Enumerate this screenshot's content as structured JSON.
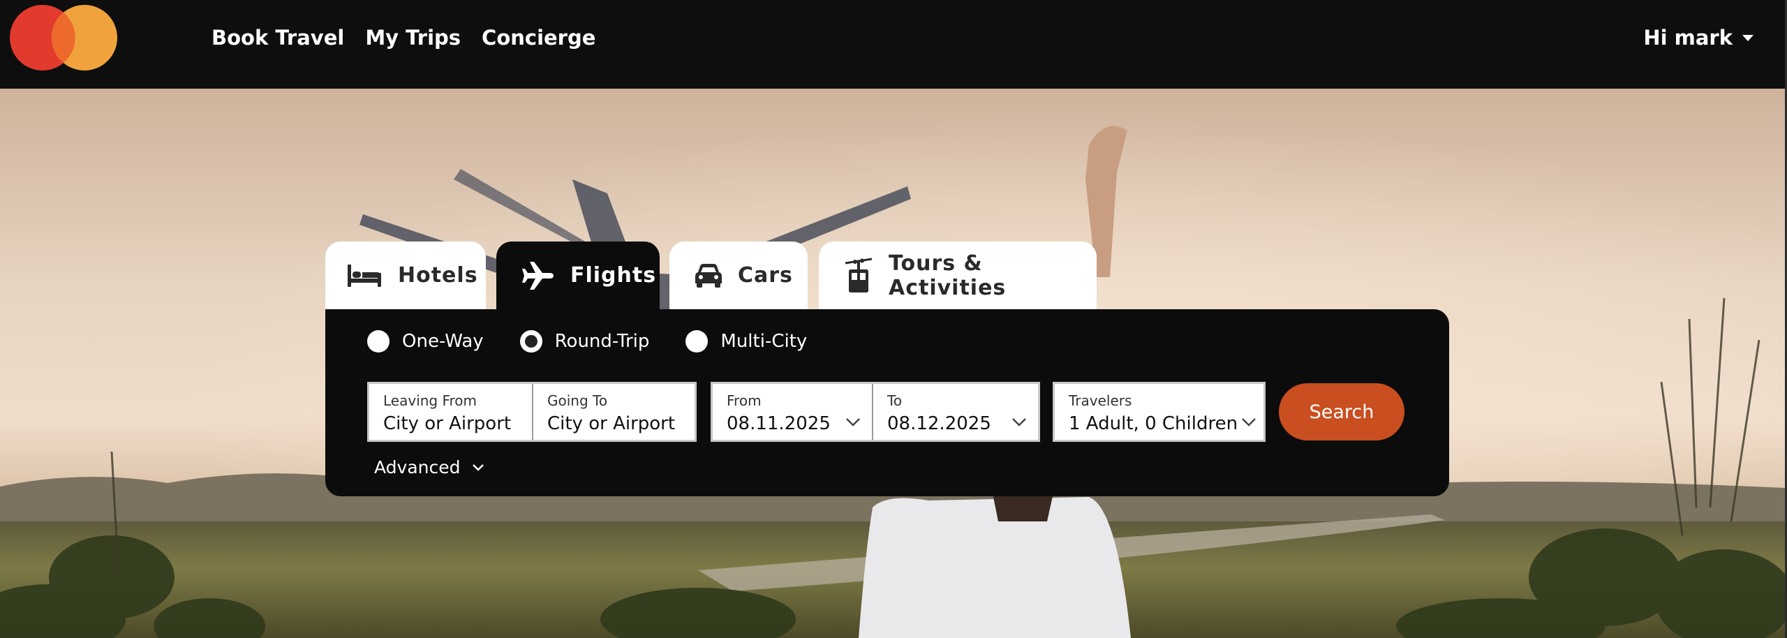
{
  "header": {
    "nav": [
      "Book Travel",
      "My Trips",
      "Concierge"
    ],
    "greeting": "Hi mark",
    "brand_colors": {
      "left": "#e23b2e",
      "right": "#f0a33d",
      "overlap": "#ee6a2c"
    }
  },
  "tabs": [
    {
      "label": "Hotels",
      "icon": "bed-icon",
      "active": false
    },
    {
      "label": "Flights",
      "icon": "airplane-icon",
      "active": true
    },
    {
      "label": "Cars",
      "icon": "car-icon",
      "active": false
    },
    {
      "label": "Tours & Activities",
      "icon": "cable-car-icon",
      "active": false
    }
  ],
  "search": {
    "trip_types": [
      {
        "label": "One-Way",
        "selected": false
      },
      {
        "label": "Round-Trip",
        "selected": true
      },
      {
        "label": "Multi-City",
        "selected": false
      }
    ],
    "leaving_from": {
      "label": "Leaving From",
      "value": "City or Airport"
    },
    "going_to": {
      "label": "Going To",
      "value": "City or Airport"
    },
    "from_date": {
      "label": "From",
      "value": "08.11.2025"
    },
    "to_date": {
      "label": "To",
      "value": "08.12.2025"
    },
    "travelers": {
      "label": "Travelers",
      "value": "1 Adult, 0 Children"
    },
    "search_label": "Search",
    "advanced_label": "Advanced"
  },
  "colors": {
    "accent": "#c94f20",
    "topbar": "#0e0e0e",
    "panel": "#0c0c0c"
  }
}
